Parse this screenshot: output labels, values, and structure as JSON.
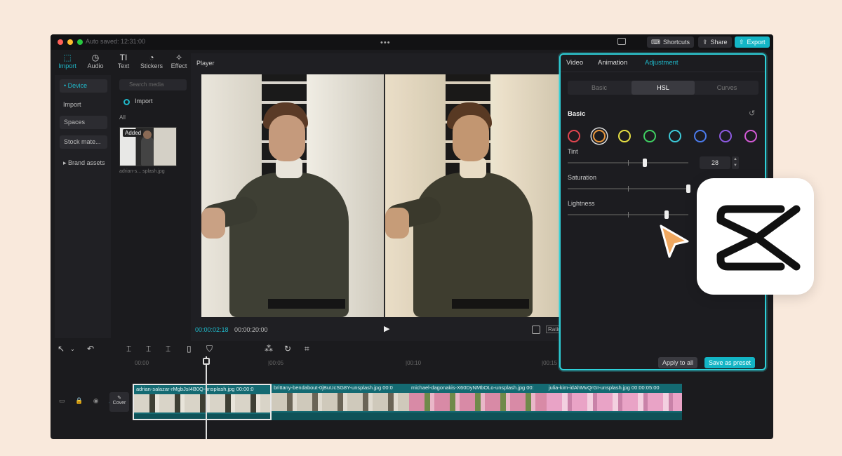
{
  "window": {
    "auto_saved": "Auto saved: 12:31:00",
    "more_dots": "•••",
    "shortcuts_label": "Shortcuts",
    "share_label": "Share",
    "export_label": "Export",
    "traffic_lights": [
      "#ff5f57",
      "#febc2e",
      "#28c840"
    ]
  },
  "media_tabs": [
    {
      "label": "Import",
      "icon": "import-icon",
      "glyph": "⬚"
    },
    {
      "label": "Audio",
      "icon": "audio-icon",
      "glyph": "◷"
    },
    {
      "label": "Text",
      "icon": "text-icon",
      "glyph": "TI"
    },
    {
      "label": "Stickers",
      "icon": "stickers-icon",
      "glyph": "◔"
    },
    {
      "label": "Effect",
      "icon": "effects-icon",
      "glyph": "✧"
    }
  ],
  "sidebar": {
    "items": [
      "• Device",
      "Import",
      "Spaces",
      "Stock mate...",
      "▸ Brand assets"
    ]
  },
  "media": {
    "search_placeholder": "Search media",
    "import_label": "Import",
    "all_label": "All",
    "added_badge": "Added",
    "thumb_name": "adrian-s... splash.jpg"
  },
  "player": {
    "title": "Player",
    "current_time": "00:00:02:18",
    "total_time": "00:00:20:00",
    "ratio_label": "Ratio"
  },
  "timeline": {
    "ticks": [
      "00:00",
      "|00:05",
      "|00:10",
      "|00:15"
    ],
    "cover_label": "Cover",
    "clips": [
      {
        "name": "adrian-salazar-rMgbJsI4B0Q-unsplash.jpg  00:00:0",
        "frame_color": "#d9d4c8"
      },
      {
        "name": "brittany-bendabout-0jBuUcSG8Y-unsplash.jpg  00:0",
        "frame_color": "#cfc9bb"
      },
      {
        "name": "michael-dagonakis-X60DyNMbOLo-unsplash.jpg  00:",
        "frame_color": "#d88aa6"
      },
      {
        "name": "julia-kim-idAhMvQrGI-unsplash.jpg  00:00:05:00",
        "frame_color": "#e9a3c6"
      }
    ]
  },
  "adjust": {
    "tabs": [
      "Video",
      "Animation",
      "Adjustment"
    ],
    "segments": [
      "Basic",
      "HSL",
      "Curves"
    ],
    "section": "Basic",
    "swatches": [
      "#e0454f",
      "#e8963c",
      "#e6e043",
      "#3fcf62",
      "#3cc9d8",
      "#4b7bec",
      "#8e5ae2",
      "#d35ad6"
    ],
    "tint_label": "Tint",
    "tint_value": "28",
    "saturation_label": "Saturation",
    "lightness_label": "Lightness",
    "apply_label": "Apply to all",
    "preset_label": "Save as preset",
    "tint_level": 0.64,
    "saturation_level": 1.0,
    "lightness_level": 0.82
  },
  "colors": {
    "accent": "#1fb8c9",
    "highlight_border": "#2ed0d8",
    "cursor": "#f0a860"
  }
}
